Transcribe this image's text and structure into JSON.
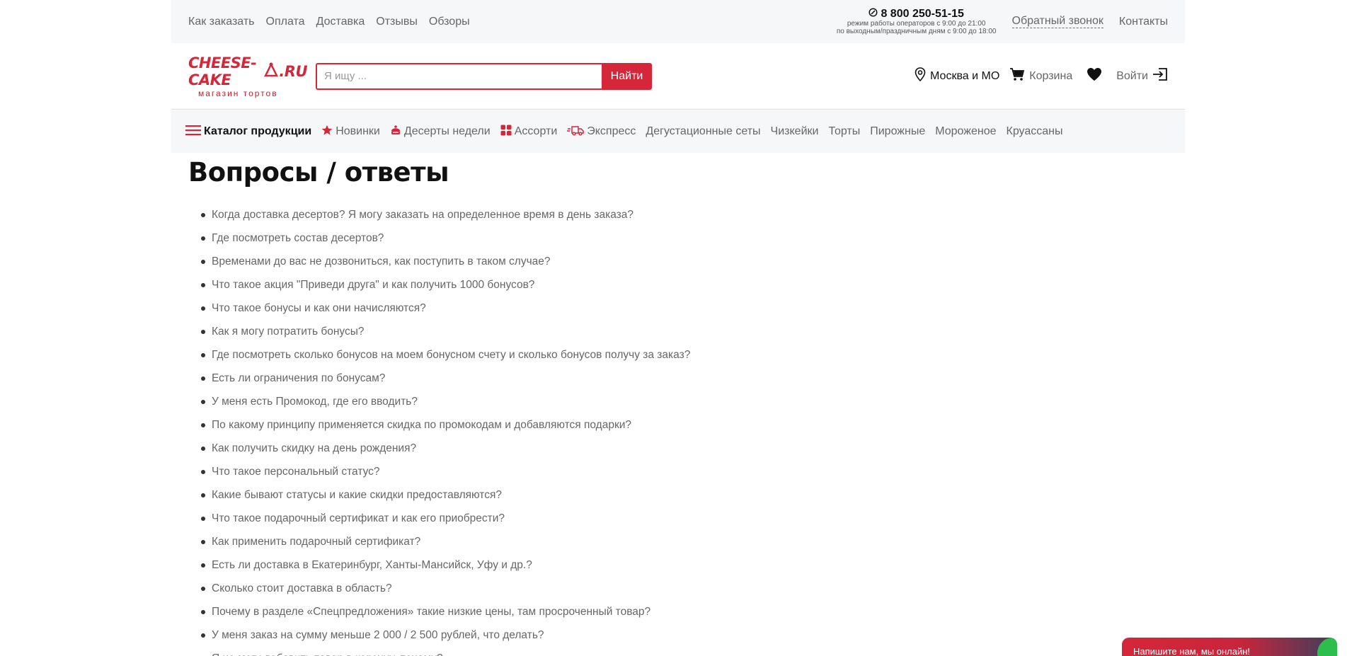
{
  "topbar": {
    "nav": [
      "Как заказать",
      "Оплата",
      "Доставка",
      "Отзывы",
      "Обзоры"
    ],
    "phone": "8 800 250-51-15",
    "hours_line1": "режим работы операторов с 9:00 до 21:00",
    "hours_line2": "по выходным/праздничным дням с 9:00 до 18:00",
    "callback": "Обратный звонок",
    "contacts": "Контакты"
  },
  "header": {
    "logo_main": "CHEESE-CAKE",
    "logo_tld": ".RU",
    "logo_sub": "магазин тортов",
    "search_placeholder": "Я ищу ...",
    "search_button": "Найти",
    "city": "Москва и МО",
    "cart": "Корзина",
    "login": "Войти"
  },
  "catnav": {
    "catalog": "Каталог продукции",
    "items": [
      "Новинки",
      "Десерты недели",
      "Ассорти",
      "Экспресс",
      "Дегустационные сеты",
      "Чизкейки",
      "Торты",
      "Пирожные",
      "Мороженое",
      "Круассаны"
    ]
  },
  "main": {
    "title": "Вопросы / ответы",
    "questions": [
      "Когда доставка десертов? Я могу заказать на определенное время в день заказа?",
      "Где посмотреть состав десертов?",
      "Временами до вас не дозвониться, как поступить в таком случае?",
      "Что такое акция \"Приведи друга\" и как получить 1000 бонусов?",
      "Что такое бонусы и как они начисляются?",
      "Как я могу потратить бонусы?",
      "Где посмотреть сколько бонусов на моем бонусном счету и сколько бонусов получу за заказ?",
      "Есть ли ограничения по бонусам?",
      "У меня есть Промокод, где его вводить?",
      "По какому принципу применяется скидка по промокодам и добавляются подарки?",
      "Как получить скидку на день рождения?",
      "Что такое персональный статус?",
      "Какие бывают статусы и какие скидки предоставляются?",
      "Что такое подарочный сертификат и как его приобрести?",
      "Как применить подарочный сертификат?",
      "Есть ли доставка в Екатеринбург, Ханты-Мансийск, Уфу и др.?",
      "Сколько стоит доставка в область?",
      "Почему в разделе «Спецпредложения» такие низкие цены, там просроченный товар?",
      "У меня заказ на сумму меньше 2 000 / 2 500 рублей, что делать?",
      "Я не могу добавить товар в корзину, почему?"
    ]
  },
  "chat": {
    "label": "Напишите нам, мы онлайн!"
  },
  "colors": {
    "brand": "#d6263a",
    "online": "#2dbd4d"
  }
}
